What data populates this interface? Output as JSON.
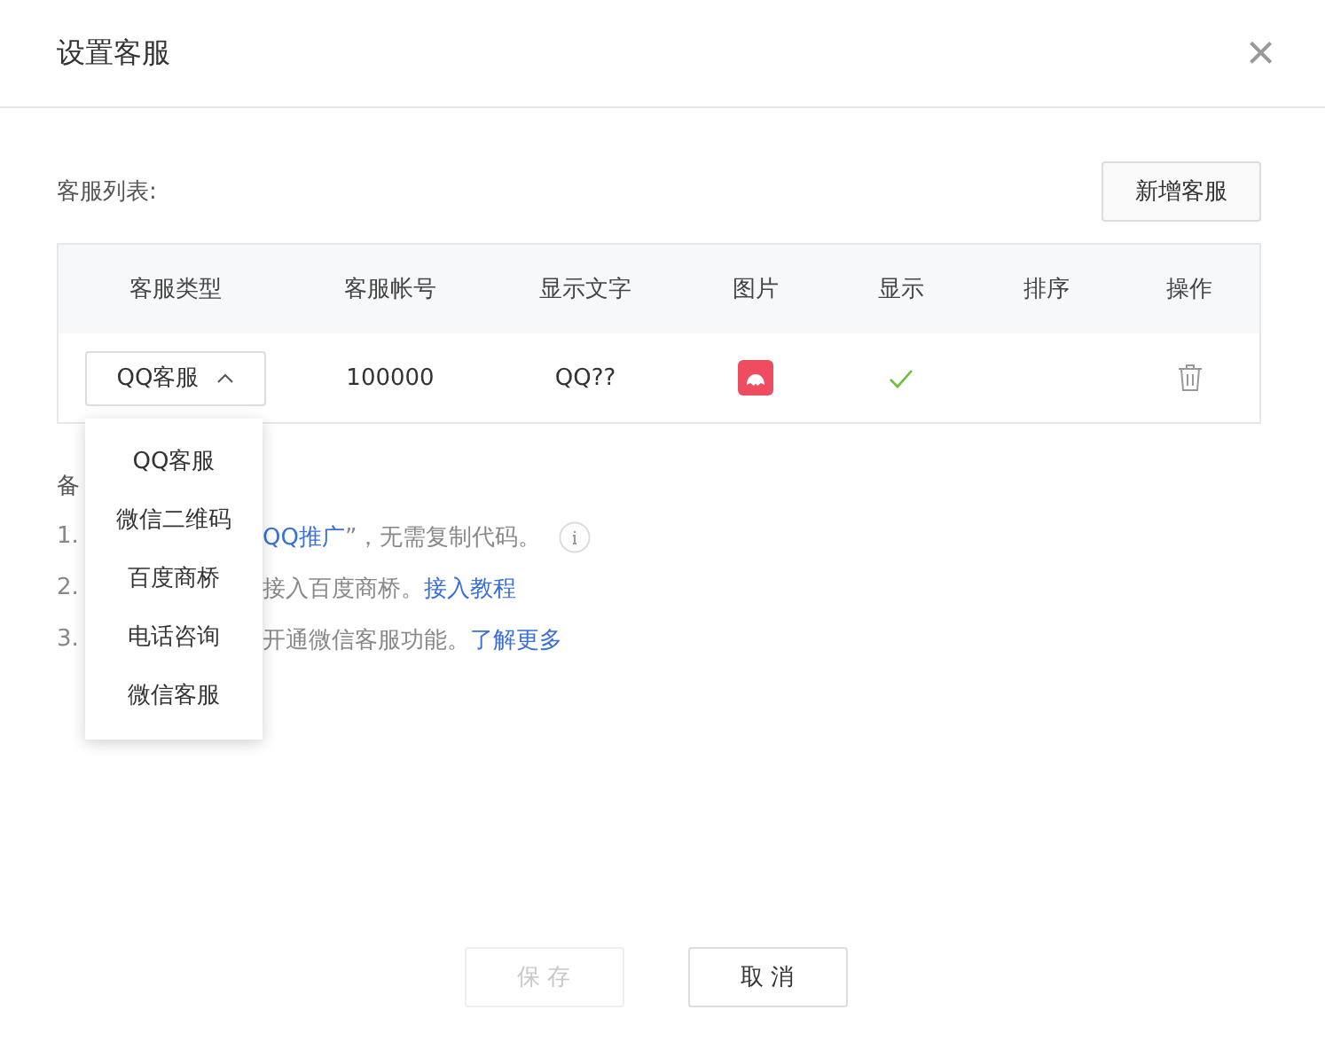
{
  "dialog": {
    "title": "设置客服",
    "close": "×"
  },
  "list_label": "客服列表:",
  "add_button": "新增客服",
  "table": {
    "columns": [
      "客服类型",
      "客服帐号",
      "显示文字",
      "图片",
      "显示",
      "排序",
      "操作"
    ],
    "rows": [
      {
        "type": "QQ客服",
        "dropdown_expanded": true,
        "account": "100000",
        "display_text": "QQ??",
        "show": true
      }
    ]
  },
  "dropdown_options": [
    {
      "label": "QQ客服"
    },
    {
      "label": "微信二维码"
    },
    {
      "label": "百度商桥"
    },
    {
      "label": "电话咨询"
    },
    {
      "label": "微信客服"
    }
  ],
  "notes": {
    "label": "备",
    "items": [
      {
        "number": "1.",
        "highlight": "QQ推广",
        "text": "”，无需复制代码。",
        "info": true
      },
      {
        "number": "2.",
        "text": "接入百度商桥。",
        "link": "接入教程",
        "info": false
      },
      {
        "number": "3.",
        "text": "开通微信客服功能。",
        "link": "了解更多",
        "info": false
      }
    ]
  },
  "buttons": [
    {
      "label": "保 存",
      "disabled": true
    },
    {
      "label": "取 消",
      "disabled": false
    }
  ]
}
